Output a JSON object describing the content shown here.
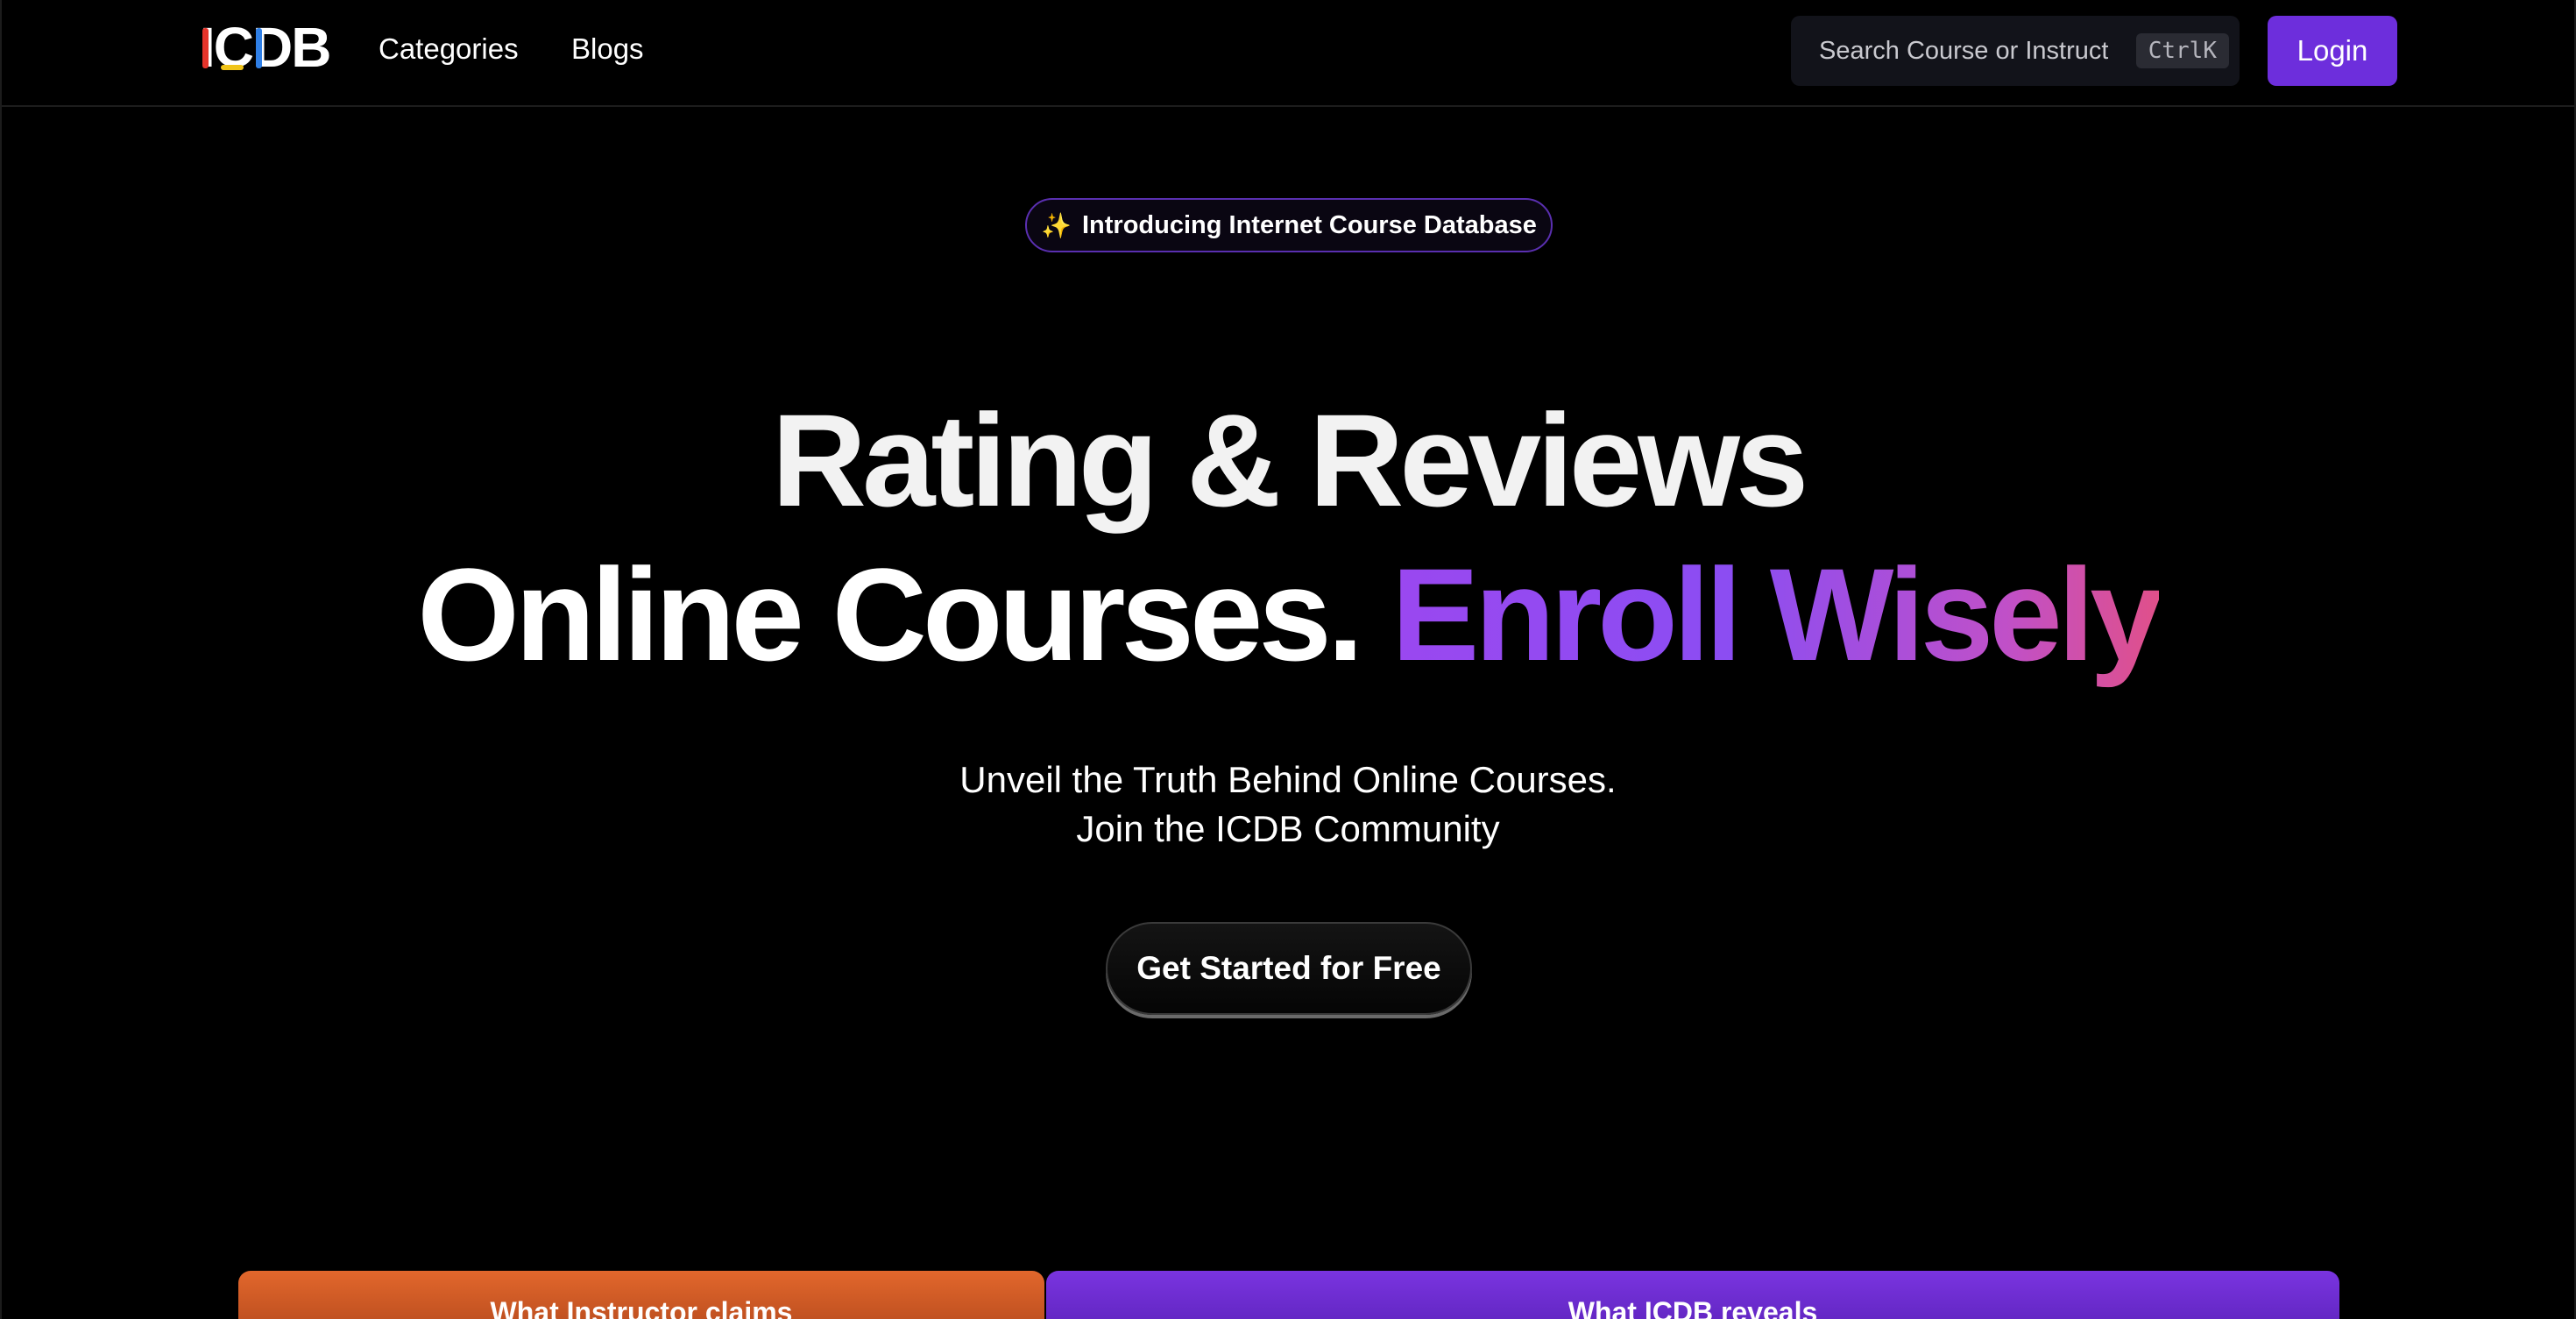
{
  "header": {
    "logo": [
      "I",
      "C",
      "D",
      "B"
    ],
    "nav": {
      "categories": "Categories",
      "blogs": "Blogs"
    },
    "search": {
      "placeholder": "Search Course or Instructor",
      "shortcut": "CtrlK"
    },
    "login_label": "Login"
  },
  "hero": {
    "badge_icon": "sparkles-icon",
    "badge_text": "Introducing Internet Course Database",
    "headline_line1": "Rating & Reviews",
    "headline_line2_plain": "Online Courses.",
    "headline_line2_gradient": "Enroll Wisely",
    "subtitle_line1": "Unveil the Truth Behind Online Courses.",
    "subtitle_line2": "Join the ICDB Community",
    "cta_label": "Get Started for Free"
  },
  "compare": {
    "claims_label": "What Instructor claims",
    "reveals_label": "What ICDB reveals"
  },
  "colors": {
    "accent": "#6d2edc",
    "gradient_start": "#9a48f0",
    "gradient_end": "#e0508a",
    "claims_tab": "#e2672c",
    "reveals_tab": "#7a34e0"
  }
}
